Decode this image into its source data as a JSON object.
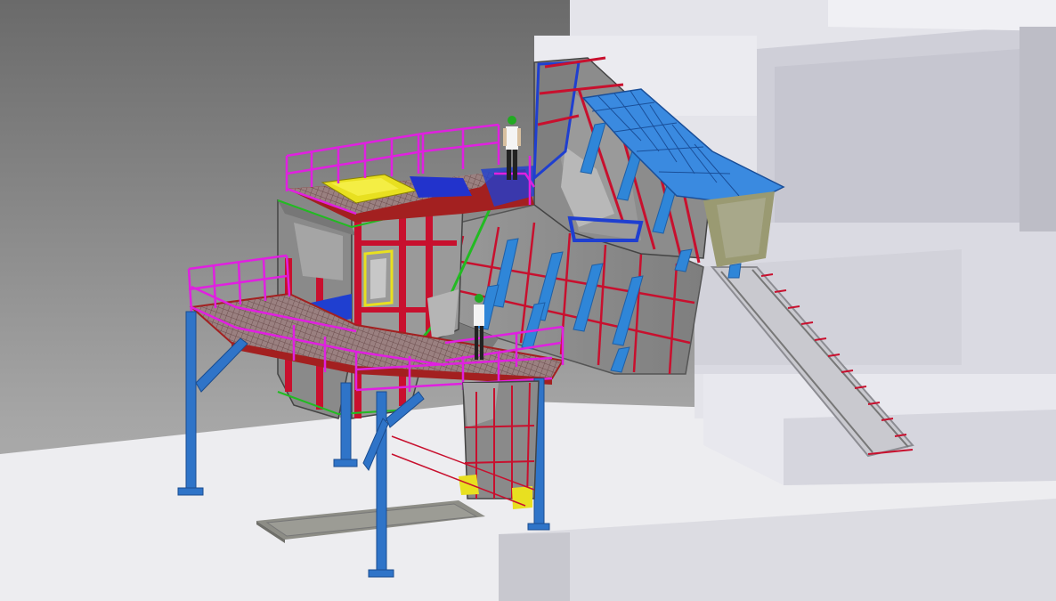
{
  "scene": {
    "kind": "3D CAD model view",
    "colors": {
      "background_top": "#6e6e6e",
      "background_mid": "#a4a4a4",
      "floor": "#ededf0",
      "concrete_light": "#e6e6ec",
      "concrete_mid": "#d2d2da",
      "concrete_dark": "#b9b9c2",
      "hopper_body": "#8f8f8f",
      "hopper_shade": "#777777",
      "stiffener_red": "#c8102e",
      "railing_magenta": "#e020e0",
      "grating": "#8e6a6a",
      "column_blue": "#2f74c8",
      "chute_liner_blue": "#3a86d8",
      "motor_yellow": "#e8e020",
      "edge_green": "#22bb22",
      "pit_gray": "#8a8a84"
    },
    "icons": [
      "worker-figure-icon",
      "worker-figure-icon"
    ]
  }
}
